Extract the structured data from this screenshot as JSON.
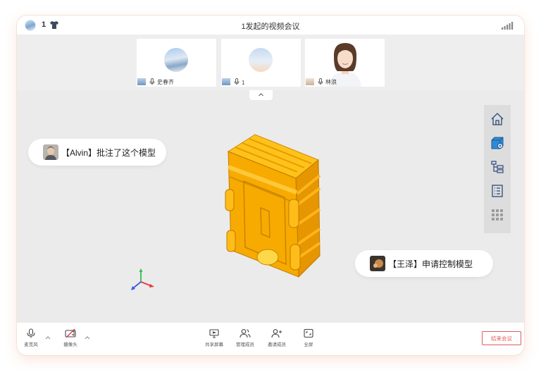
{
  "topbar": {
    "participant_count": "1",
    "title": "1发起的视频会议"
  },
  "participants": [
    {
      "name": "史春齐",
      "avatar": "landscape-avatar"
    },
    {
      "name": "1",
      "avatar": "sky-avatar"
    },
    {
      "name": "林浪",
      "avatar": "person-avatar"
    }
  ],
  "annotations": {
    "first": "【Alvin】批注了这个模型",
    "second": "【王泽】申请控制模型"
  },
  "sidetools": [
    "home-icon",
    "cube-settings-icon",
    "tree-structure-icon",
    "list-icon",
    "grid-icon"
  ],
  "toolbar": {
    "mic_label": "麦克风",
    "camera_label": "摄像头",
    "share_label": "共享屏幕",
    "manage_label": "管理成员",
    "invite_label": "邀请成员",
    "fullscreen_label": "全屏",
    "end_label": "结束会议"
  },
  "colors": {
    "model": "#f5a800",
    "end_button": "#e25a5a",
    "axis_x": "#e23b3b",
    "axis_y": "#2fbf4a",
    "axis_z": "#3b5be2"
  }
}
